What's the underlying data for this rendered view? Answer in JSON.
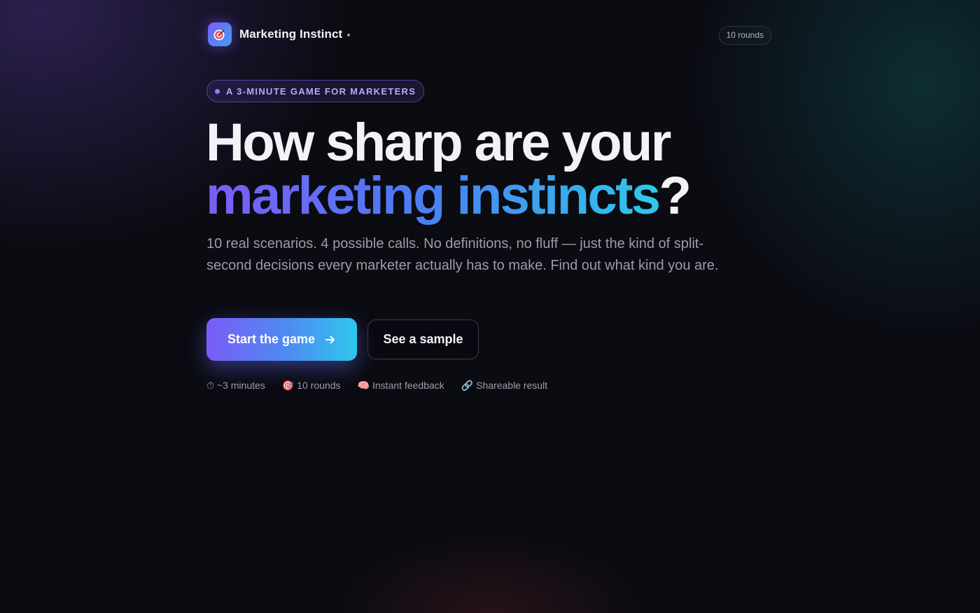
{
  "header": {
    "brand_name": "Marketing Instinct",
    "rounds_badge": "10 rounds"
  },
  "hero": {
    "eyebrow": "A 3-MINUTE GAME FOR MARKETERS",
    "headline_line1": "How sharp are your",
    "headline_gradient": "marketing instincts",
    "headline_end": "?",
    "subtitle": "10 real scenarios. 4 possible calls. No definitions, no fluff — just the kind of split-second decisions every marketer actually has to make. Find out what kind you are."
  },
  "actions": {
    "primary_label": "Start the game",
    "secondary_label": "See a sample"
  },
  "features": [
    {
      "icon": "timer-icon",
      "glyph": "⏱",
      "label": "~3 minutes"
    },
    {
      "icon": "target-icon",
      "glyph": "🎯",
      "label": "10 rounds"
    },
    {
      "icon": "brain-icon",
      "glyph": "🧠",
      "label": "Instant feedback"
    },
    {
      "icon": "link-icon",
      "glyph": "🔗",
      "label": "Shareable result"
    }
  ],
  "colors": {
    "background": "#0b0b12",
    "accent_purple": "#7a5cf6",
    "accent_cyan": "#2ec8ec",
    "eyebrow_text": "#b6aaf6"
  },
  "icons": {
    "logo": "target-icon",
    "primary_button": "arrow-right-icon"
  }
}
